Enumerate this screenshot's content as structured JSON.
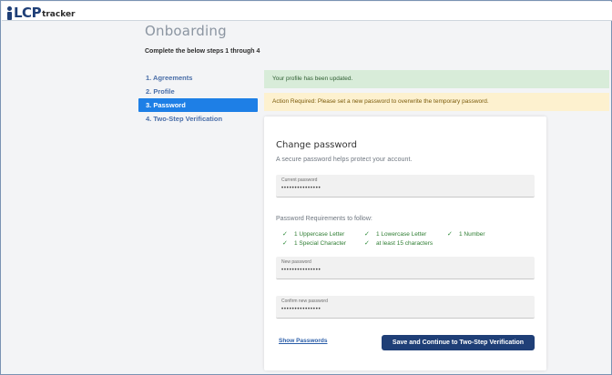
{
  "logo": {
    "brand": "LCP",
    "product": "tracker"
  },
  "page": {
    "title": "Onboarding",
    "subtitle": "Complete the below steps 1 through 4"
  },
  "steps": [
    {
      "label": "1. Agreements",
      "active": false
    },
    {
      "label": "2. Profile",
      "active": false
    },
    {
      "label": "3. Password",
      "active": true
    },
    {
      "label": "4. Two-Step Verification",
      "active": false
    }
  ],
  "alerts": {
    "success": "Your profile has been updated.",
    "warning": "Action Required: Please set a new password to overwrite the temporary password."
  },
  "card": {
    "title": "Change password",
    "description": "A secure password helps protect your account.",
    "current_password": {
      "label": "Current password",
      "value": "•••••••••••••••"
    },
    "requirements_heading": "Password Requirements to follow:",
    "requirements": [
      "1 Uppercase Letter",
      "1 Lowercase Letter",
      "1 Number",
      "1 Special Character",
      "at least 15 characters"
    ],
    "new_password": {
      "label": "New password",
      "value": "•••••••••••••••"
    },
    "confirm_password": {
      "label": "Confirm new password",
      "value": "•••••••••••••••"
    },
    "show_passwords": "Show Passwords",
    "submit": "Save and Continue to Two-Step Verification"
  },
  "colors": {
    "accent": "#1e7fe6",
    "primary_button": "#1f3f77",
    "success_bg": "#d8ecd9",
    "warning_bg": "#fdf1cf",
    "check": "#2e8b3a"
  },
  "icons": [
    "person-logo-icon",
    "check-icon"
  ]
}
